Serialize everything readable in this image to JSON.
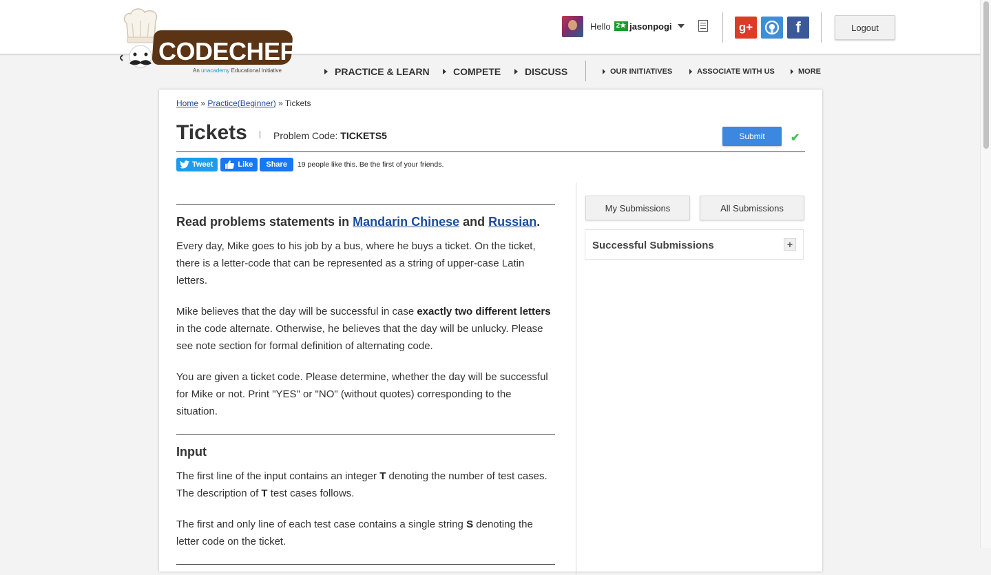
{
  "header": {
    "logo_text": "CODECHEF",
    "logo_tagline_prefix": "An",
    "logo_tagline_brand": "unacademy",
    "logo_tagline_suffix": "Educational Initiative",
    "greeting": "Hello",
    "rating_badge": "2★",
    "username": "jasonpogi",
    "logout_label": "Logout",
    "social": [
      "google-plus",
      "github",
      "facebook"
    ]
  },
  "nav": {
    "main": [
      "PRACTICE & LEARN",
      "COMPETE",
      "DISCUSS"
    ],
    "secondary": [
      "OUR INITIATIVES",
      "ASSOCIATE WITH US",
      "MORE"
    ]
  },
  "breadcrumb": {
    "home": "Home",
    "sep1": "»",
    "practice": "Practice(Beginner)",
    "sep2": "»",
    "current": "Tickets"
  },
  "problem": {
    "title": "Tickets",
    "code_label": "Problem Code:",
    "code": "TICKETS5",
    "submit_label": "Submit"
  },
  "share": {
    "tweet": "Tweet",
    "like": "Like",
    "share": "Share",
    "like_text": "19 people like this. Be the first of your friends."
  },
  "statement": {
    "read_prefix": "Read problems statements in",
    "lang1": "Mandarin Chinese",
    "and": "and",
    "lang2": "Russian",
    "period": ".",
    "p1": "Every day, Mike goes to his job by a bus, where he buys a ticket. On the ticket, there is a letter-code that can be represented as a string of upper-case Latin letters.",
    "p2_a": "Mike believes that the day will be successful in case",
    "p2_b": "exactly two different letters",
    "p2_c": "in the code alternate. Otherwise, he believes that the day will be unlucky. Please see note section for formal definition of alternating code.",
    "p3": "You are given a ticket code. Please determine, whether the day will be successful for Mike or not. Print \"YES\" or \"NO\" (without quotes) corresponding to the situation.",
    "input_heading": "Input",
    "in1_a": "The first line of the input contains an integer",
    "in1_b": "T",
    "in1_c": "denoting the number of test cases. The description of",
    "in1_d": "T",
    "in1_e": "test cases follows.",
    "in2_a": "The first and only line of each test case contains a single string",
    "in2_b": "S",
    "in2_c": "denoting the letter code on the ticket."
  },
  "sidebar": {
    "my_submissions": "My Submissions",
    "all_submissions": "All Submissions",
    "successful_title": "Successful Submissions",
    "expand": "+"
  }
}
